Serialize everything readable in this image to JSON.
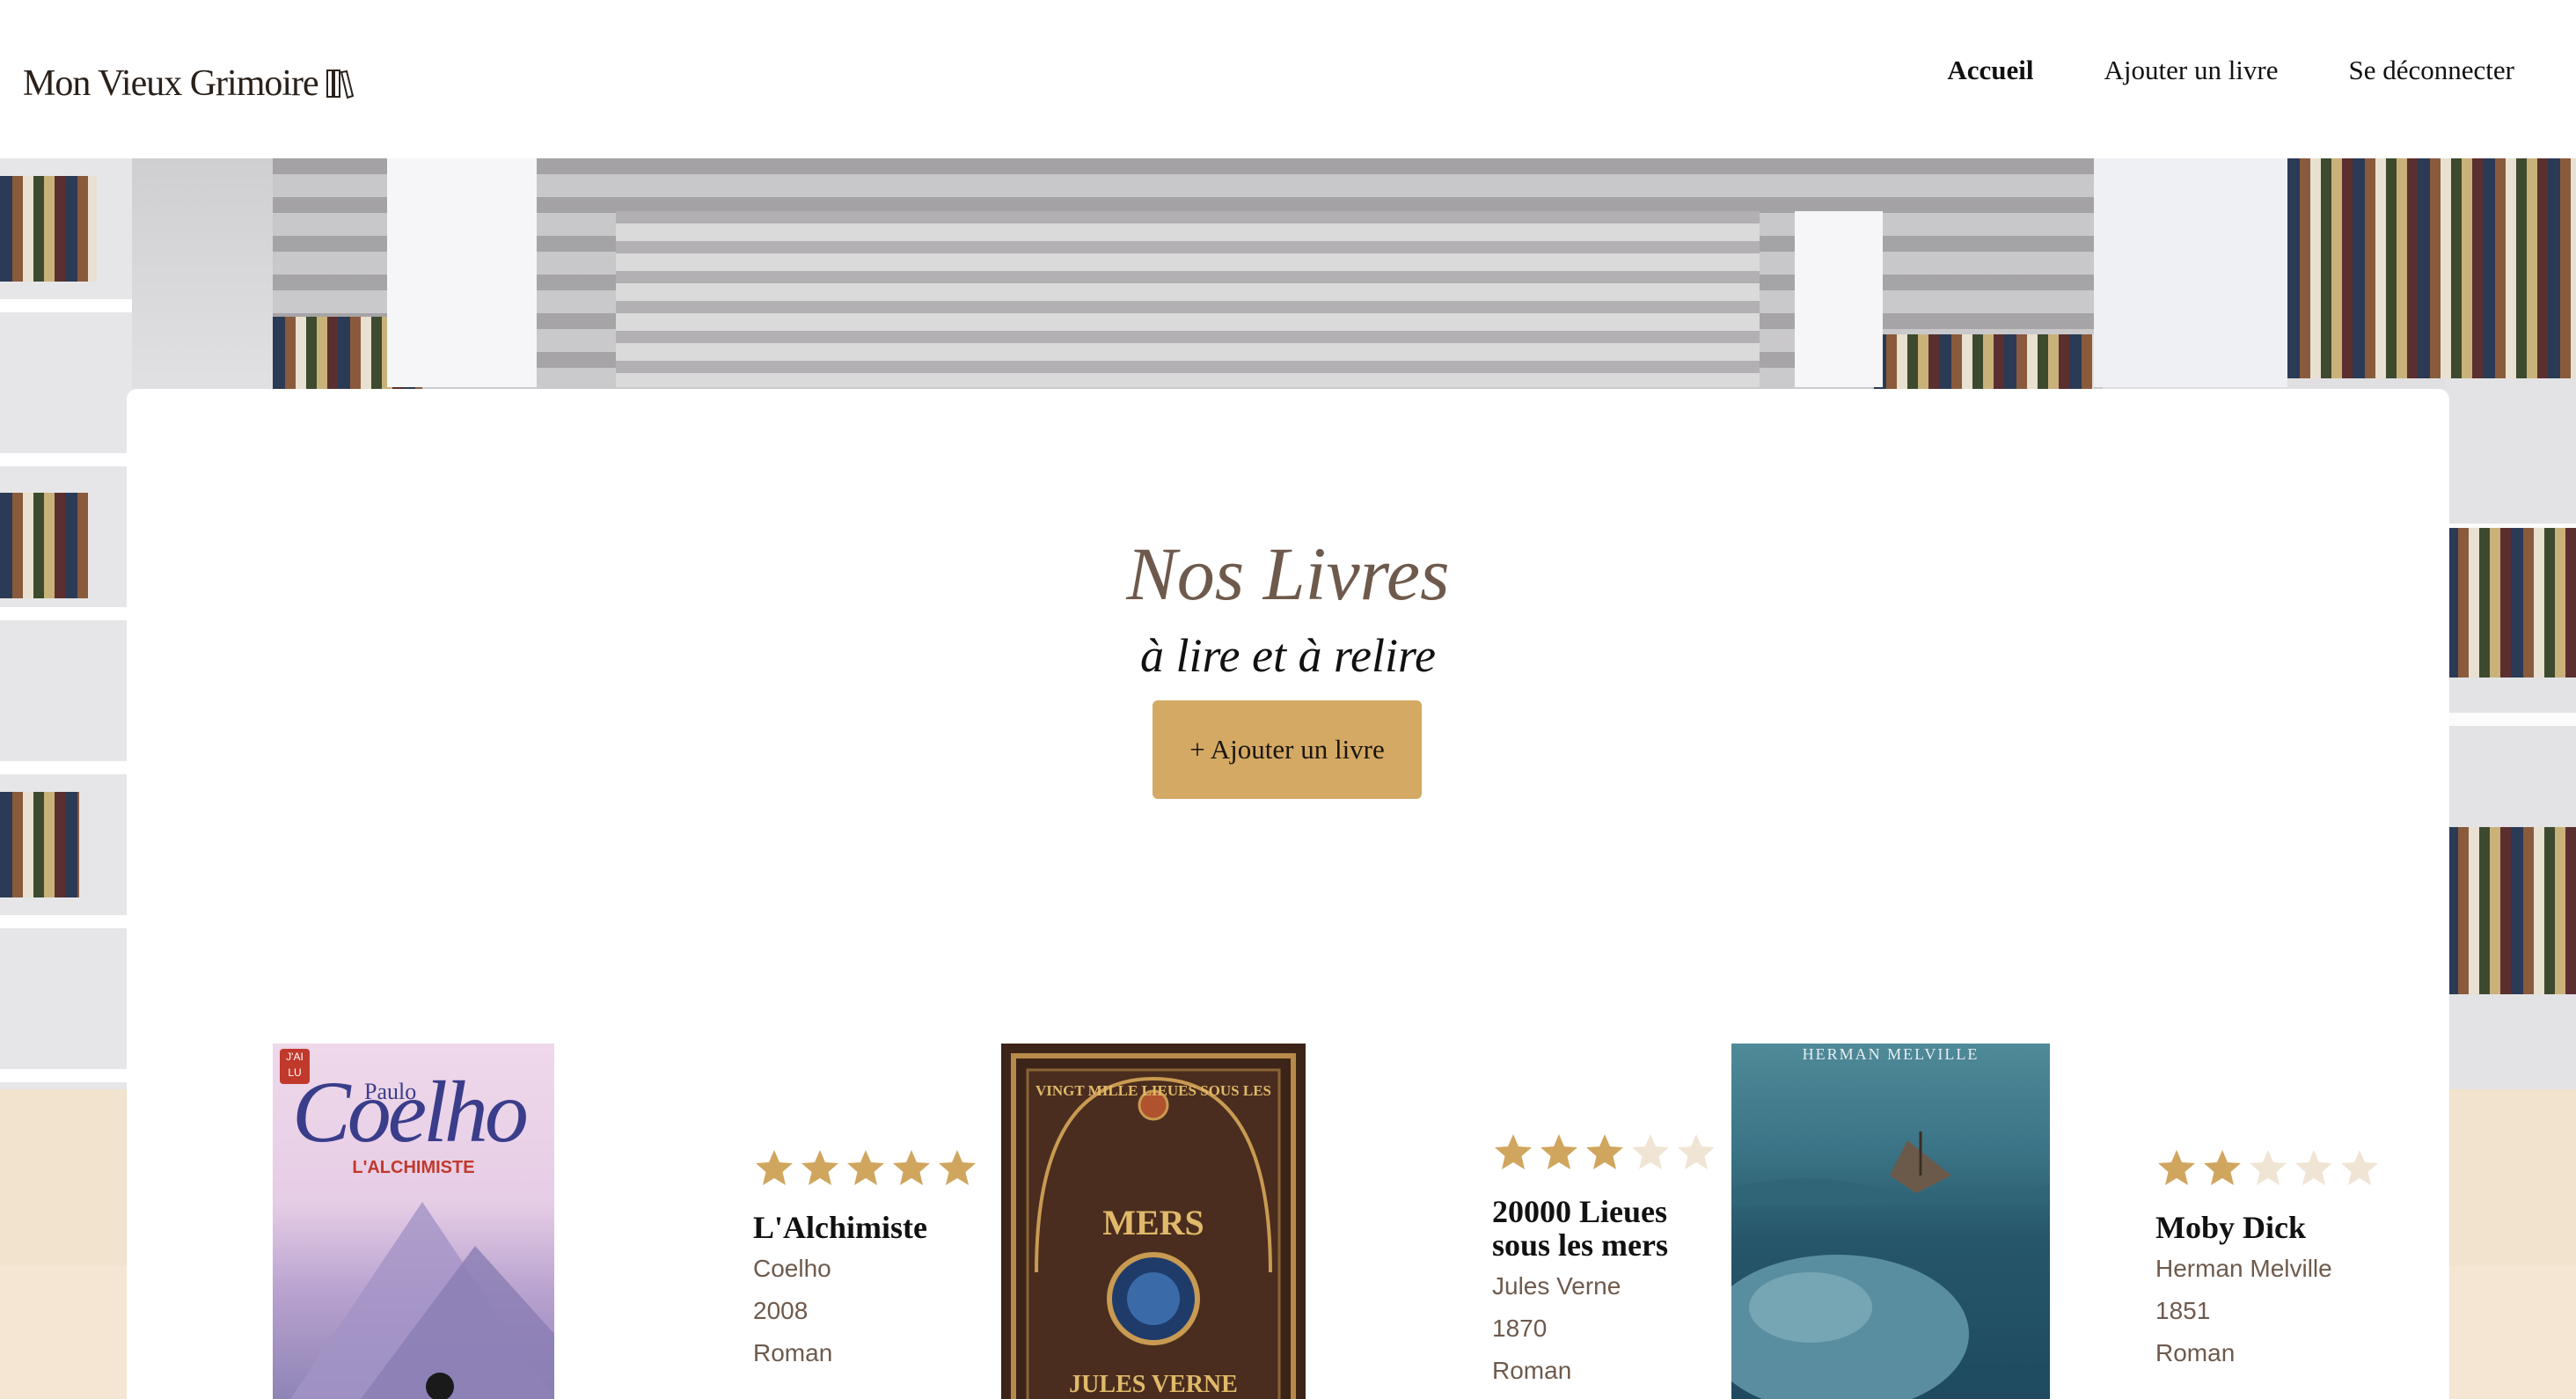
{
  "header": {
    "logo": "Mon Vieux Grimoire",
    "nav": [
      {
        "label": "Accueil",
        "active": true
      },
      {
        "label": "Ajouter un livre",
        "active": false
      },
      {
        "label": "Se déconnecter",
        "active": false
      }
    ]
  },
  "main": {
    "title": "Nos Livres",
    "subtitle": "à lire et à relire",
    "add_button": "+ Ajouter un livre"
  },
  "books": [
    {
      "title": "L'Alchimiste",
      "author": "Coelho",
      "year": "2008",
      "genre": "Roman",
      "rating": 5,
      "cover_text": {
        "publisher": "J'AI LU",
        "author_first": "Paulo",
        "author_last": "Coelho",
        "title": "L'ALCHIMISTE"
      }
    },
    {
      "title_line1": "20000 Lieues",
      "title_line2": "sous les mers",
      "author": "Jules Verne",
      "year": "1870",
      "genre": "Roman",
      "rating": 3,
      "cover_text": {
        "arc": "VINGT MILLE LIEUES SOUS LES",
        "word": "MERS",
        "author": "JULES VERNE"
      }
    },
    {
      "title": "Moby Dick",
      "author": "Herman Melville",
      "year": "1851",
      "genre": "Roman",
      "rating": 2,
      "cover_text": {
        "author": "HERMAN MELVILLE"
      }
    }
  ],
  "colors": {
    "accent": "#d4a964",
    "star_filled": "#d0a65e",
    "star_empty": "#f0e5d4",
    "title_brown": "#6e5a4c",
    "footer_band": "#f1e3cd"
  },
  "icons": [
    "books-logo-icon",
    "star-icon"
  ]
}
